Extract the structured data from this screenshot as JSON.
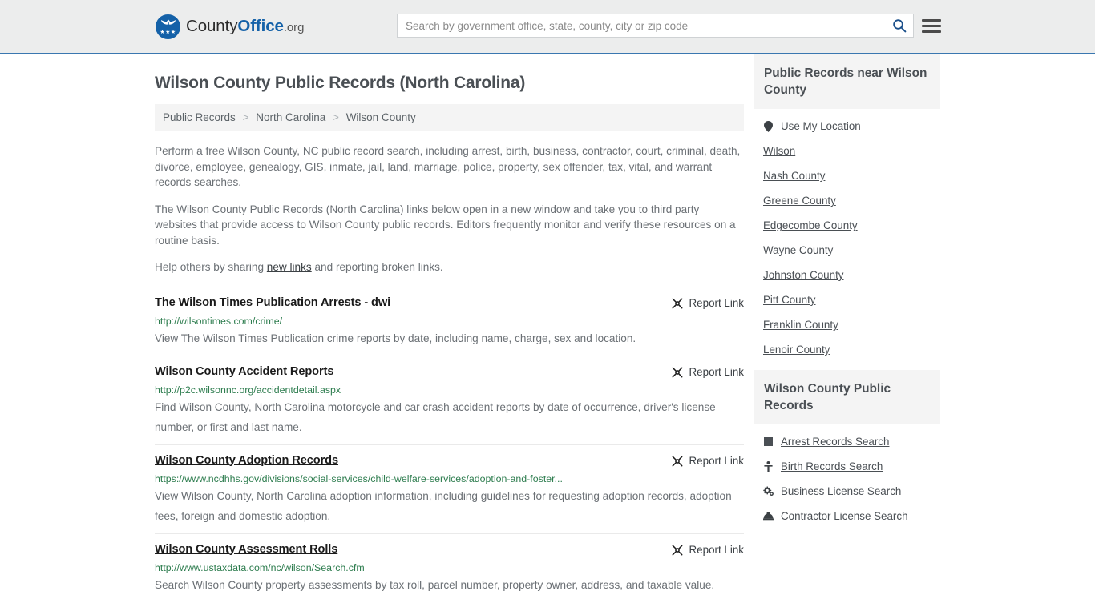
{
  "header": {
    "logo": {
      "text_part1": "County",
      "text_part2": "Office",
      "text_part3": ".org",
      "badge_icon": "eagle-seal-icon",
      "stars": "★★★"
    },
    "search": {
      "placeholder": "Search by government office, state, county, city or zip code",
      "value": "",
      "search_icon": "search-icon"
    },
    "menu_icon": "hamburger-menu-icon"
  },
  "page": {
    "title": "Wilson County Public Records (North Carolina)"
  },
  "breadcrumb": {
    "items": [
      {
        "label": "Public Records"
      },
      {
        "label": "North Carolina"
      },
      {
        "label": "Wilson County"
      }
    ],
    "separator": ">"
  },
  "intro": {
    "paragraph1": "Perform a free Wilson County, NC public record search, including arrest, birth, business, contractor, court, criminal, death, divorce, employee, genealogy, GIS, inmate, jail, land, marriage, police, property, sex offender, tax, vital, and warrant records searches.",
    "paragraph2": "The Wilson County Public Records (North Carolina) links below open in a new window and take you to third party websites that provide access to Wilson County public records. Editors frequently monitor and verify these resources on a routine basis.",
    "paragraph3_pre": "Help others by sharing ",
    "paragraph3_link": "new links",
    "paragraph3_post": " and reporting broken links."
  },
  "results": {
    "report_label": "Report Link",
    "report_icon": "unlink-icon",
    "items": [
      {
        "title": "The Wilson Times Publication Arrests - dwi",
        "url": "http://wilsontimes.com/crime/",
        "description": "View The Wilson Times Publication crime reports by date, including name, charge, sex and location."
      },
      {
        "title": "Wilson County Accident Reports",
        "url": "http://p2c.wilsonnc.org/accidentdetail.aspx",
        "description": "Find Wilson County, North Carolina motorcycle and car crash accident reports by date of occurrence, driver's license number, or first and last name."
      },
      {
        "title": "Wilson County Adoption Records",
        "url": "https://www.ncdhhs.gov/divisions/social-services/child-welfare-services/adoption-and-foster...",
        "description": "View Wilson County, North Carolina adoption information, including guidelines for requesting adoption records, adoption fees, foreign and domestic adoption."
      },
      {
        "title": "Wilson County Assessment Rolls",
        "url": "http://www.ustaxdata.com/nc/wilson/Search.cfm",
        "description": "Search Wilson County property assessments by tax roll, parcel number, property owner, address, and taxable value."
      }
    ]
  },
  "sidebar": {
    "nearby": {
      "heading": "Public Records near Wilson County",
      "items": [
        {
          "label": "Use My Location",
          "icon": "map-pin-icon"
        },
        {
          "label": "Wilson",
          "icon": ""
        },
        {
          "label": "Nash County",
          "icon": ""
        },
        {
          "label": "Greene County",
          "icon": ""
        },
        {
          "label": "Edgecombe County",
          "icon": ""
        },
        {
          "label": "Wayne County",
          "icon": ""
        },
        {
          "label": "Johnston County",
          "icon": ""
        },
        {
          "label": "Pitt County",
          "icon": ""
        },
        {
          "label": "Franklin County",
          "icon": ""
        },
        {
          "label": "Lenoir County",
          "icon": ""
        }
      ]
    },
    "records": {
      "heading": "Wilson County Public Records",
      "items": [
        {
          "label": "Arrest Records Search",
          "icon": "square-icon"
        },
        {
          "label": "Birth Records Search",
          "icon": "child-icon"
        },
        {
          "label": "Business License Search",
          "icon": "gears-icon"
        },
        {
          "label": "Contractor License Search",
          "icon": "hard-hat-icon"
        }
      ]
    }
  },
  "colors": {
    "brand_blue": "#1461a8",
    "header_bg": "#eceded",
    "header_border": "#3a77b0",
    "url_green": "#2e7d4f",
    "panel_bg": "#f4f4f4",
    "text_gray": "#6b7075"
  }
}
